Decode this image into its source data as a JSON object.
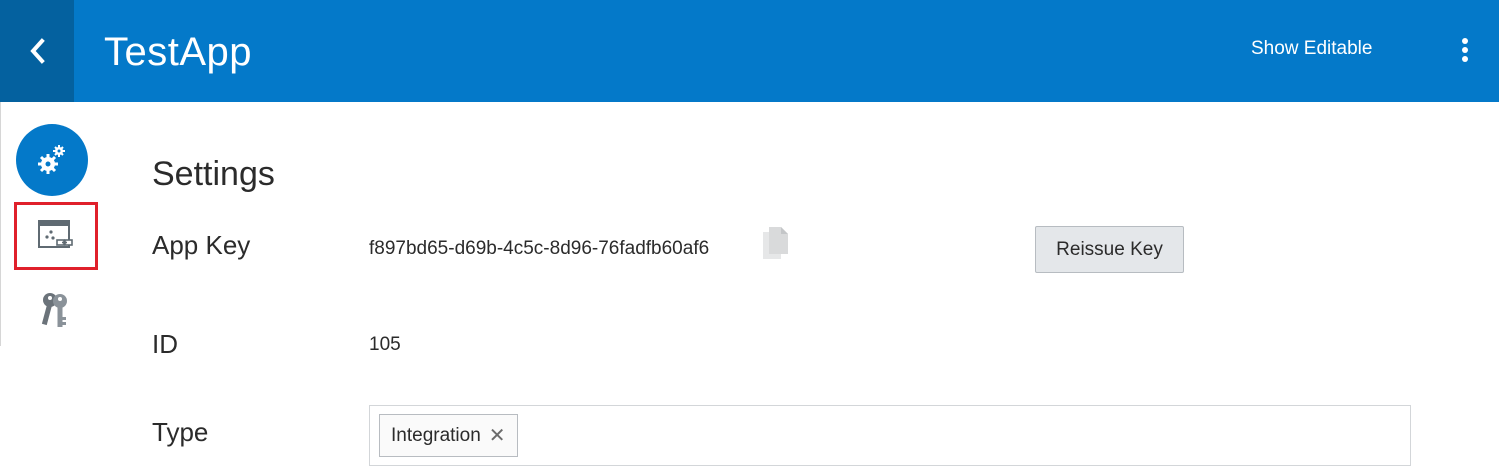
{
  "header": {
    "app_title": "TestApp",
    "show_editable_label": "Show Editable",
    "back_icon": "chevron-left-icon",
    "more_icon": "kebab-vertical-icon",
    "bg_color": "#0479c9",
    "back_bg_color": "#04619f"
  },
  "sidebar": {
    "items": [
      {
        "icon": "settings-gears-icon",
        "selected": true
      },
      {
        "icon": "app-integration-icon",
        "highlighted": true
      },
      {
        "icon": "keys-icon"
      }
    ]
  },
  "settings": {
    "title": "Settings",
    "app_key_label": "App Key",
    "app_key_value": "f897bd65-d69b-4c5c-8d96-76fadfb60af6",
    "copy_icon": "copy-icon",
    "reissue_label": "Reissue Key",
    "id_label": "ID",
    "id_value": "105",
    "type_label": "Type",
    "type_chips": [
      {
        "label": "Integration",
        "remove_glyph": "✕"
      }
    ]
  }
}
